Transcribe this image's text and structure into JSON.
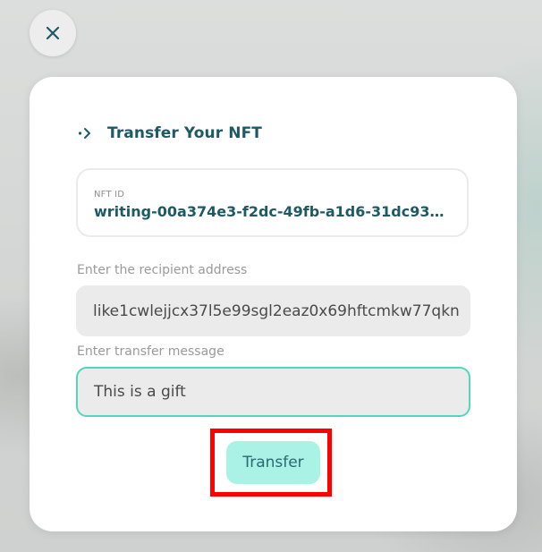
{
  "dialog": {
    "close_icon": "close-icon",
    "title": "Transfer Your NFT",
    "title_icon": "transfer-arrow-icon"
  },
  "nft": {
    "label": "NFT ID",
    "value": "writing-00a374e3-f2dc-49fb-a1d6-31dc93574b..."
  },
  "recipient": {
    "label": "Enter the recipient address",
    "value": "like1cwlejjcx37l5e99sgl2eaz0x69hftcmkw77qkn"
  },
  "message": {
    "label": "Enter transfer message",
    "value": "This is a gift"
  },
  "actions": {
    "transfer_label": "Transfer"
  },
  "colors": {
    "accent": "#1e5a63",
    "button_bg": "#aaf1e6",
    "focus_border": "#50d7bd",
    "highlight": "#ff0000"
  }
}
